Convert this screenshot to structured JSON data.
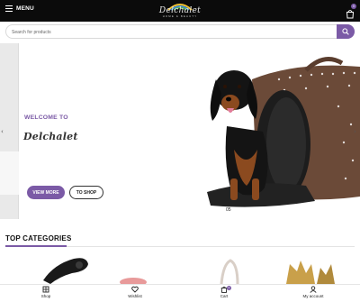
{
  "header": {
    "menu_label": "MENU",
    "logo_text": "Delchalet",
    "logo_subtext": "HOME & BEAUTY",
    "cart_count": "0"
  },
  "search": {
    "placeholder": "Search for products"
  },
  "hero": {
    "welcome": "WELCOME TO",
    "brand": "Delchalet",
    "view_more_label": "VIEW MORE",
    "to_shop_label": "TO SHOP",
    "slide_number": "05"
  },
  "categories": {
    "title": "TOP CATEGORIES"
  },
  "bottom_nav": {
    "items": [
      {
        "label": "Shop",
        "icon": "shop-icon"
      },
      {
        "label": "Wishlist",
        "icon": "heart-icon"
      },
      {
        "label": "Cart",
        "icon": "cart-icon"
      },
      {
        "label": "My account",
        "icon": "user-icon"
      }
    ],
    "cart_count": "0"
  },
  "colors": {
    "accent": "#7b5aa6",
    "header_bg": "#0b0b0b"
  }
}
